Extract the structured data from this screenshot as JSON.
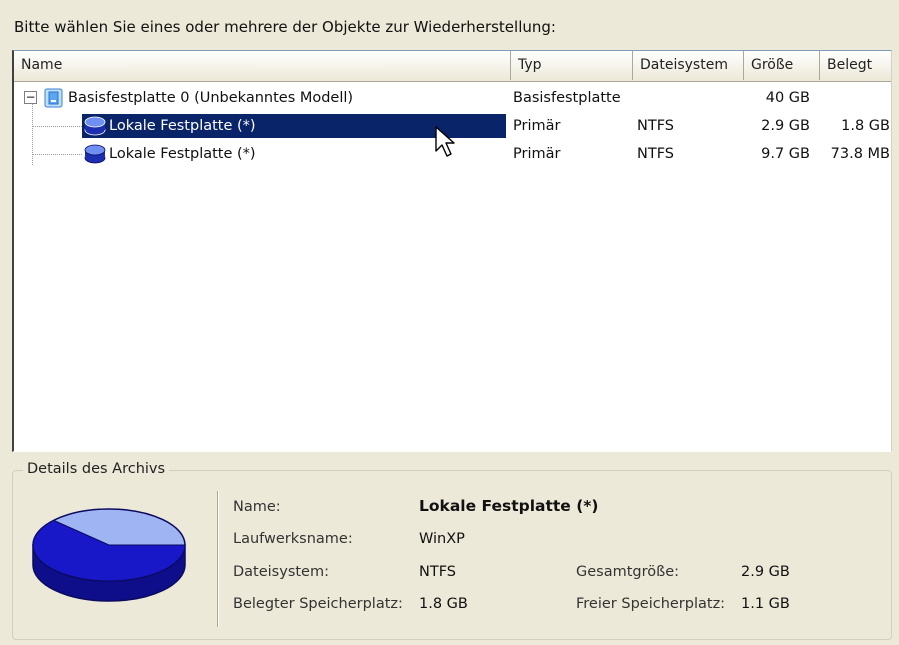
{
  "prompt": "Bitte wählen Sie eines oder mehrere der Objekte zur Wiederherstellung:",
  "columns": {
    "name": "Name",
    "typ": "Typ",
    "dateisystem": "Dateisystem",
    "groesse": "Größe",
    "belegt": "Belegt"
  },
  "rows": [
    {
      "name": "Basisfestplatte 0 (Unbekanntes Modell)",
      "typ": "Basisfestplatte",
      "dateisystem": "",
      "groesse": "40 GB",
      "belegt": "",
      "icon": "hard-disk-icon"
    },
    {
      "name": "Lokale Festplatte (*)",
      "typ": "Primär",
      "dateisystem": "NTFS",
      "groesse": "2.9 GB",
      "belegt": "1.8 GB",
      "icon": "partition-icon",
      "selected": true
    },
    {
      "name": "Lokale Festplatte (*)",
      "typ": "Primär",
      "dateisystem": "NTFS",
      "groesse": "9.7 GB",
      "belegt": "73.8 MB",
      "icon": "partition-icon"
    }
  ],
  "tree_toggle": "−",
  "details": {
    "legend": "Details des Archivs",
    "name_label": "Name:",
    "name_value": "Lokale Festplatte (*)",
    "laufwerk_label": "Laufwerksname:",
    "laufwerk_value": "WinXP",
    "fs_label": "Dateisystem:",
    "fs_value": "NTFS",
    "gesamt_label": "Gesamtgröße:",
    "gesamt_value": "2.9 GB",
    "belegt_label": "Belegter Speicherplatz:",
    "belegt_value": "1.8 GB",
    "frei_label": "Freier Speicherplatz:",
    "frei_value": "1.1 GB",
    "pie_used_fraction": 0.62
  },
  "colors": {
    "selection": "#0a246a",
    "pie_used": "#1818c8",
    "pie_free": "#9fb4f2",
    "pie_edge": "#0a0a60"
  }
}
